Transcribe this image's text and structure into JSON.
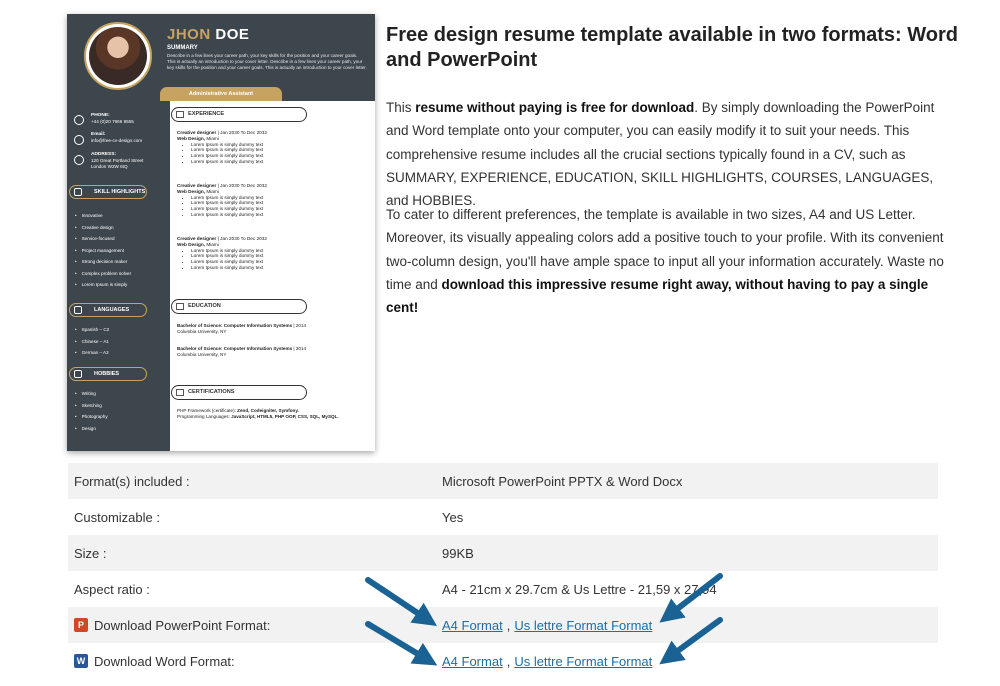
{
  "resume_preview": {
    "name_first": "JHON",
    "name_last": "DOE",
    "summary_title": "SUMMARY",
    "summary_text": "Describe in a few lines your career path, your key skills for the position and your career goals. This is actually an introduction to your cover letter. Describe in a few lines your career path, your key skills for the position and your career goals. This is actually an introduction to your cover letter.",
    "role": "Administrative Assistant",
    "contact": {
      "phone_label": "PHONE:",
      "phone": "+44 (0)20 7666 8555",
      "email_label": "Email:",
      "email": "info@free-cv-design.com",
      "address_label": "ADDRESS:",
      "address_1": "120 Great Portland Street",
      "address_2": "London W2W 6tQ"
    },
    "skills_title": "SKILL HIGHLIGHTS",
    "skills": [
      "Innovative",
      "Creative design",
      "Service-focused",
      "Project management",
      "Strong decision maker",
      "Complex problem solver",
      "Lorem Ipsum is simply"
    ],
    "languages_title": "LANGUAGES",
    "languages": [
      "Spanish – C2",
      "Chinese – A1",
      "German – A2"
    ],
    "hobbies_title": "HOBBIES",
    "hobbies": [
      "Writing",
      "Sketching",
      "Photography",
      "Design"
    ],
    "experience_title": "EXPERIENCE",
    "jobs": [
      {
        "title": "Creative designer",
        "dates": " | Jan 2030 To Dec 2032",
        "company": "Web Design,",
        "city": " Miami",
        "bullets": [
          "Lorem Ipsum is simply dummy text",
          "Lorem Ipsum is simply dummy text",
          "Lorem Ipsum is simply dummy text",
          "Lorem Ipsum is simply dummy text"
        ]
      },
      {
        "title": "Creative designer",
        "dates": " | Jan 2030 To Dec 2032",
        "company": "Web Design,",
        "city": " Miami",
        "bullets": [
          "Lorem Ipsum is simply dummy text",
          "Lorem Ipsum is simply dummy text",
          "Lorem Ipsum is simply dummy text",
          "Lorem Ipsum is simply dummy text"
        ]
      },
      {
        "title": "Creative designer",
        "dates": " | Jan 2030 To Dec 2032",
        "company": "Web Design,",
        "city": " Miami",
        "bullets": [
          "Lorem Ipsum is simply dummy text",
          "Lorem Ipsum is simply dummy text",
          "Lorem Ipsum is simply dummy text",
          "Lorem Ipsum is simply dummy text"
        ]
      }
    ],
    "education_title": "EDUCATION",
    "education": [
      {
        "degree": "Bachelor of Science: Computer Information Systems",
        "year": " | 2014",
        "school": "Columbia University, NY"
      },
      {
        "degree": "Bachelor of Science: Computer Information Systems",
        "year": " | 2014",
        "school": "Columbia University, NY"
      }
    ],
    "certifications_title": "CERTIFICATIONS",
    "cert_1_label": "PHP Framework (certificate): ",
    "cert_1_value": "Zend, Codeigniter, Symfony.",
    "cert_2_label": "Programming Languages: ",
    "cert_2_value": "JavaScript, HTML5, PHP OOP, CSS, SQL, MySQL."
  },
  "article": {
    "title": "Free design resume template available in two formats: Word and PowerPoint",
    "p1_a": "This ",
    "p1_b": "resume without paying is free for download",
    "p1_c": ". By simply downloading the PowerPoint and Word template onto your computer, you can easily modify it to suit your needs. This comprehensive resume includes all the crucial sections typically found in a CV, such as SUMMARY, EXPERIENCE, EDUCATION, SKILL HIGHLIGHTS, COURSES, LANGUAGES, and HOBBIES.",
    "p2_a": "To cater to different preferences, the template is available in two sizes, A4 and US Letter. Moreover, its visually appealing colors add a positive touch to your profile. With its convenient two-column design, you'll have ample space to input all your information accurately. Waste no time and ",
    "p2_b": "download this impressive resume right away, without having to pay a single cent!"
  },
  "info_table": {
    "rows": [
      {
        "label": "Format(s) included :",
        "value": "Microsoft PowerPoint PPTX & Word Docx"
      },
      {
        "label": "Customizable :",
        "value": "Yes"
      },
      {
        "label": "Size :",
        "value": "99KB"
      },
      {
        "label": "Aspect ratio :",
        "value": "A4 - 21cm x 29.7cm & Us Lettre - 21,59 x 27,94"
      }
    ],
    "ppt_row": {
      "label": "Download PowerPoint Format:",
      "icon": "powerpoint-icon",
      "link_a4": "A4 Format",
      "sep": ",",
      "link_us": "Us lettre Format Format"
    },
    "word_row": {
      "label": "Download Word Format:",
      "icon": "word-icon",
      "link_a4": "A4 Format",
      "sep": ",",
      "link_us": "Us lettre Format Format"
    }
  },
  "colors": {
    "resume_dark": "#3d464d",
    "resume_gold": "#c7a361",
    "link": "#1b6fa6",
    "arrow": "#1a6294",
    "row_stripe": "#f2f2f2"
  }
}
